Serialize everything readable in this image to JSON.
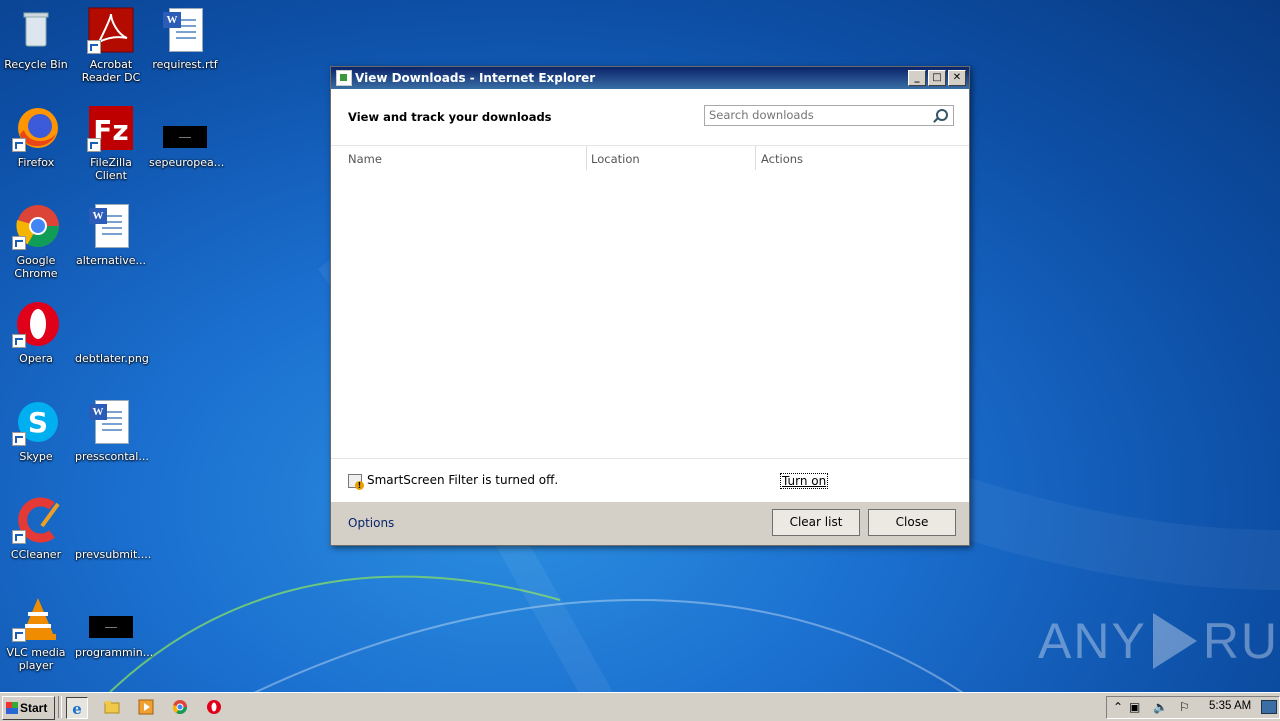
{
  "desktop": {
    "icons": [
      {
        "label": "Recycle Bin",
        "icon": "recycle-bin-icon"
      },
      {
        "label": "Acrobat Reader DC",
        "icon": "acrobat-reader-icon"
      },
      {
        "label": "requirest.rtf",
        "icon": "word-document-icon"
      },
      {
        "label": "Firefox",
        "icon": "firefox-icon"
      },
      {
        "label": "FileZilla Client",
        "icon": "filezilla-icon"
      },
      {
        "label": "sepeuropea...",
        "icon": "black-file-icon"
      },
      {
        "label": "Google Chrome",
        "icon": "chrome-icon"
      },
      {
        "label": "alternative...",
        "icon": "word-document-icon"
      },
      {
        "label": "Opera",
        "icon": "opera-icon"
      },
      {
        "label": "debtlater.png",
        "icon": "image-file-icon"
      },
      {
        "label": "Skype",
        "icon": "skype-icon"
      },
      {
        "label": "presscontal...",
        "icon": "word-document-icon"
      },
      {
        "label": "CCleaner",
        "icon": "ccleaner-icon"
      },
      {
        "label": "prevsubmit....",
        "icon": "image-file-icon"
      },
      {
        "label": "VLC media player",
        "icon": "vlc-icon"
      },
      {
        "label": "programmin...",
        "icon": "black-file-icon"
      }
    ]
  },
  "window": {
    "title": "View Downloads - Internet Explorer",
    "controls": {
      "minimize": "_",
      "maximize": "□",
      "close": "✕"
    },
    "heading": "View and track your downloads",
    "search_placeholder": "Search downloads",
    "columns": [
      "Name",
      "Location",
      "Actions"
    ],
    "smartscreen_text": "SmartScreen Filter is turned off.",
    "turn_on_label": "Turn on",
    "options_label": "Options",
    "clear_list_label": "Clear list",
    "close_label": "Close"
  },
  "watermark": {
    "left": "ANY",
    "right": "RUN"
  },
  "taskbar": {
    "start_label": "Start",
    "clock": "5:35 AM"
  },
  "colors": {
    "title_bar": "#0a246a",
    "desktop": "#1b6fcf",
    "taskbar": "#d4d0c8"
  }
}
